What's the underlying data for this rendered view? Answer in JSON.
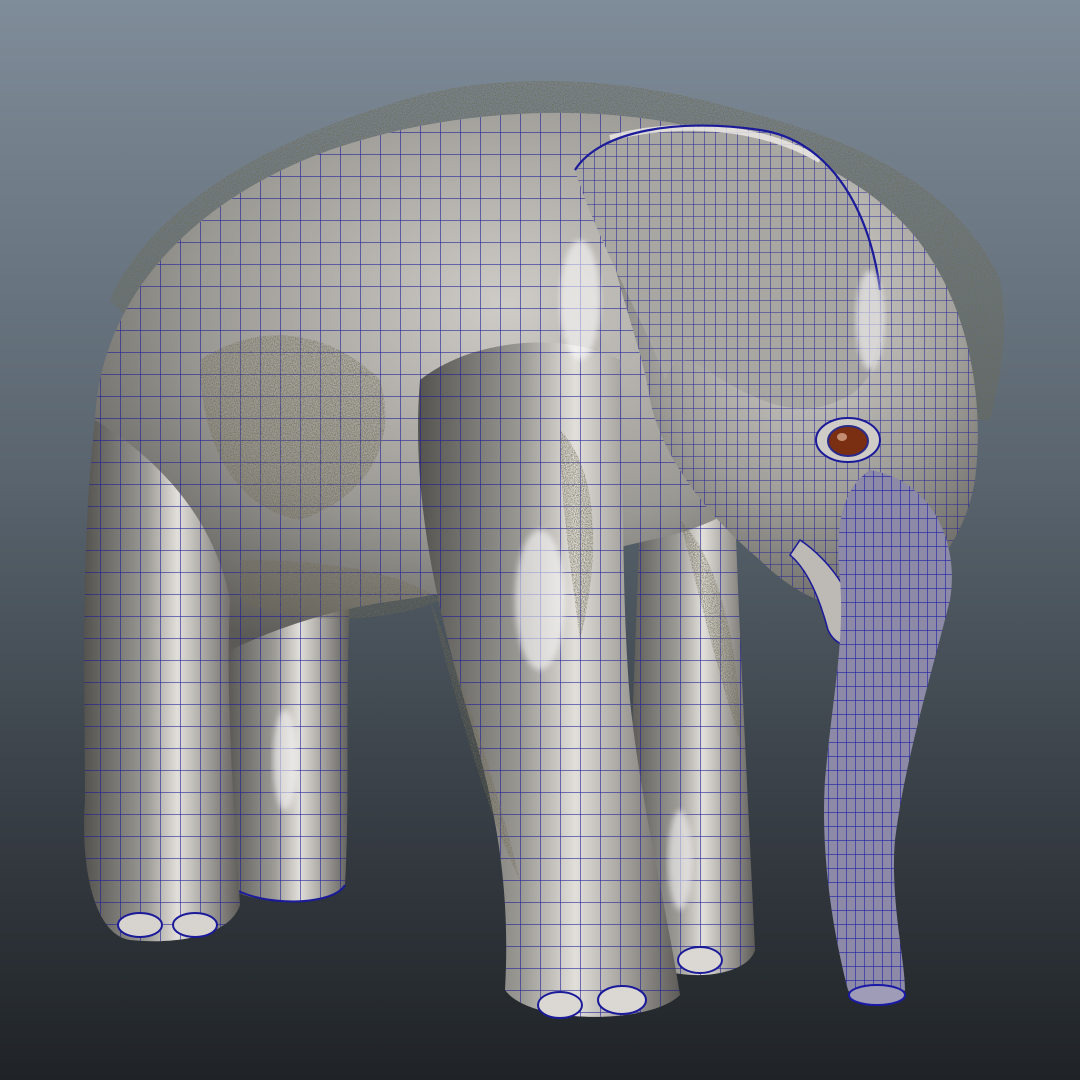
{
  "viewport": {
    "background_top": "#7f8c99",
    "background_bottom": "#1f2327"
  },
  "model": {
    "subject": "elephant-calf",
    "skin_color": "#9a9893",
    "skin_highlight": "#ece9e4",
    "skin_shadow": "#4d4b47",
    "wireframe_color": "#1a1a9a",
    "fur_color": "#2a2618",
    "eye_color": "#7a2f12"
  }
}
